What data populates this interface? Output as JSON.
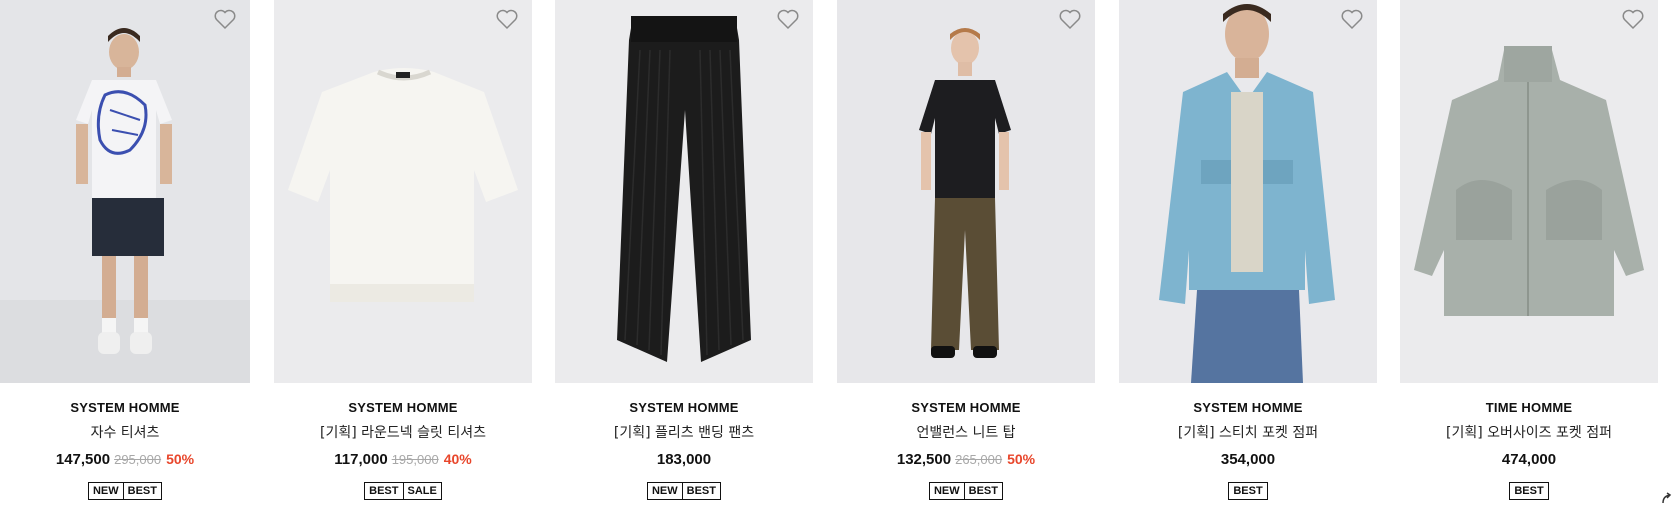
{
  "products": [
    {
      "brand": "SYSTEM HOMME",
      "name": "자수 티셔츠",
      "price": "147,500",
      "original": "295,000",
      "discount": "50%",
      "badges": [
        "NEW",
        "BEST"
      ],
      "image": "model-white-tshirt-shorts"
    },
    {
      "brand": "SYSTEM HOMME",
      "name": "[기획] 라운드넥 슬릿 티셔츠",
      "price": "117,000",
      "original": "195,000",
      "discount": "40%",
      "badges": [
        "BEST",
        "SALE"
      ],
      "image": "white-tshirt-flat"
    },
    {
      "brand": "SYSTEM HOMME",
      "name": "[기획] 플리츠 밴딩 팬츠",
      "price": "183,000",
      "original": "",
      "discount": "",
      "badges": [
        "NEW",
        "BEST"
      ],
      "image": "black-pleated-pants"
    },
    {
      "brand": "SYSTEM HOMME",
      "name": "언밸런스 니트 탑",
      "price": "132,500",
      "original": "265,000",
      "discount": "50%",
      "badges": [
        "NEW",
        "BEST"
      ],
      "image": "model-black-knit-brown-pants"
    },
    {
      "brand": "SYSTEM HOMME",
      "name": "[기획] 스티치 포켓 점퍼",
      "price": "354,000",
      "original": "",
      "discount": "",
      "badges": [
        "BEST"
      ],
      "image": "model-blue-suede-jacket"
    },
    {
      "brand": "TIME HOMME",
      "name": "[기획] 오버사이즈 포켓 점퍼",
      "price": "474,000",
      "original": "",
      "discount": "",
      "badges": [
        "BEST"
      ],
      "image": "grey-oversized-jacket"
    }
  ],
  "colors": {
    "discount": "#e8462b",
    "strike": "#a8a8a8",
    "image_bg": "#ebebed"
  },
  "icons": {
    "wishlist": "heart-outline-icon"
  }
}
